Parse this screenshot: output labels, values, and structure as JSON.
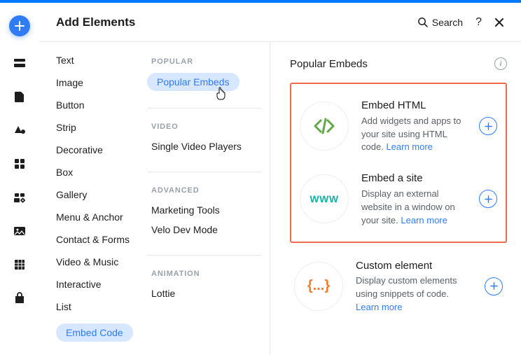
{
  "header": {
    "title": "Add Elements",
    "search": "Search",
    "help": "?",
    "close": "Close"
  },
  "categories": [
    "Text",
    "Image",
    "Button",
    "Strip",
    "Decorative",
    "Box",
    "Gallery",
    "Menu & Anchor",
    "Contact & Forms",
    "Video & Music",
    "Interactive",
    "List",
    "Embed Code"
  ],
  "categories_active_index": 12,
  "subcats": {
    "popular_heading": "POPULAR",
    "popular_items": [
      "Popular Embeds"
    ],
    "popular_active_index": 0,
    "video_heading": "VIDEO",
    "video_items": [
      "Single Video Players"
    ],
    "advanced_heading": "ADVANCED",
    "advanced_items": [
      "Marketing Tools",
      "Velo Dev Mode"
    ],
    "animation_heading": "ANIMATION",
    "animation_items": [
      "Lottie"
    ]
  },
  "content": {
    "title": "Popular Embeds",
    "learn_more": "Learn more",
    "cards": [
      {
        "name": "Embed HTML",
        "desc": "Add widgets and apps to your site using HTML code."
      },
      {
        "name": "Embed a site",
        "desc": "Display an external website in a window on your site."
      },
      {
        "name": "Custom element",
        "desc": "Display custom elements using snippets of code."
      }
    ],
    "www_label": "WWW",
    "curly_label": "{...}"
  }
}
